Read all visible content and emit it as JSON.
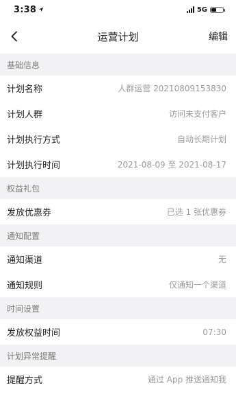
{
  "status_bar": {
    "time": "3:38",
    "network": "5G"
  },
  "nav": {
    "title": "运营计划",
    "edit": "编辑"
  },
  "sections": [
    {
      "title": "基础信息",
      "rows": [
        {
          "label": "计划名称",
          "value": "人群运营 20210809153830"
        },
        {
          "label": "计划人群",
          "value": "访问未支付客户"
        },
        {
          "label": "计划执行方式",
          "value": "自动长期计划"
        },
        {
          "label": "计划执行时间",
          "value": "2021-08-09 至 2021-08-17"
        }
      ]
    },
    {
      "title": "权益礼包",
      "rows": [
        {
          "label": "发放优惠券",
          "value": "已选 1 张优惠券"
        }
      ]
    },
    {
      "title": "通知配置",
      "rows": [
        {
          "label": "通知渠道",
          "value": "无"
        },
        {
          "label": "通知规则",
          "value": "仅通知一个渠道"
        }
      ]
    },
    {
      "title": "时间设置",
      "rows": [
        {
          "label": "发放权益时间",
          "value": "07:30"
        }
      ]
    },
    {
      "title": "计划异常提醒",
      "rows": [
        {
          "label": "提醒方式",
          "value": "通过 App 推送通知我"
        }
      ]
    }
  ],
  "battery_level": 0.45
}
